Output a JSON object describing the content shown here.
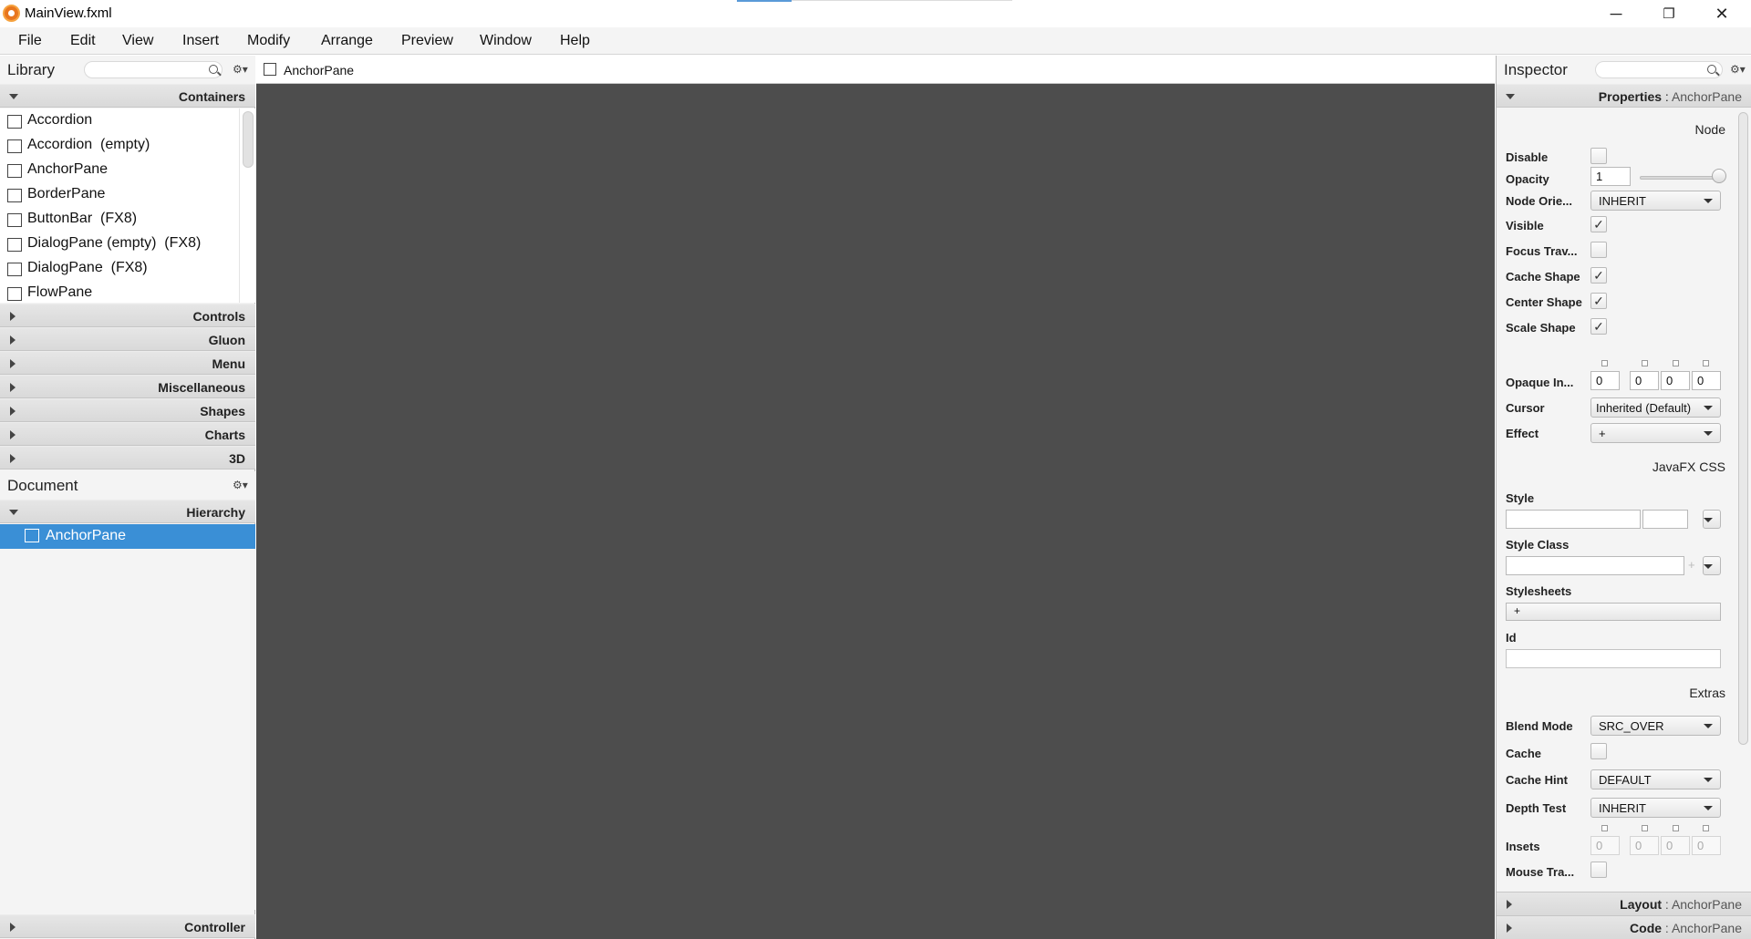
{
  "window": {
    "title": "MainView.fxml",
    "controls": {
      "minimize": "─",
      "restore": "❐",
      "close": "✕"
    }
  },
  "menu": [
    "File",
    "Edit",
    "View",
    "Insert",
    "Modify",
    "Arrange",
    "Preview",
    "Window",
    "Help"
  ],
  "library": {
    "title": "Library",
    "gear": "⚙▾",
    "open_section": "Containers",
    "items": [
      "Accordion",
      "Accordion  (empty)",
      "AnchorPane",
      "BorderPane",
      "ButtonBar  (FX8)",
      "DialogPane (empty)  (FX8)",
      "DialogPane  (FX8)",
      "FlowPane"
    ],
    "sections": [
      "Controls",
      "Gluon",
      "Menu",
      "Miscellaneous",
      "Shapes",
      "Charts",
      "3D"
    ]
  },
  "document": {
    "title": "Document",
    "gear": "⚙▾",
    "hierarchy_label": "Hierarchy",
    "selected_node": "AnchorPane",
    "controller_label": "Controller"
  },
  "canvas": {
    "breadcrumb": "AnchorPane"
  },
  "inspector": {
    "title": "Inspector",
    "gear": "⚙▾",
    "properties_label": "Properties",
    "separator": " : ",
    "target": "AnchorPane",
    "groups": {
      "node": "Node",
      "css": "JavaFX CSS",
      "extras": "Extras"
    },
    "node": {
      "disable": "Disable",
      "opacity": "Opacity",
      "opacity_value": "1",
      "node_orientation": "Node Orie...",
      "node_orientation_value": "INHERIT",
      "visible": "Visible",
      "focus_traversable": "Focus Trav...",
      "cache_shape": "Cache Shape",
      "center_shape": "Center Shape",
      "scale_shape": "Scale Shape",
      "opaque_insets": "Opaque In...",
      "opaque_insets_values": [
        "0",
        "0",
        "0",
        "0"
      ],
      "cursor": "Cursor",
      "cursor_value": "Inherited (Default)",
      "effect": "Effect",
      "effect_value": "+",
      "check_mark": "✓"
    },
    "css": {
      "style": "Style",
      "style_class": "Style Class",
      "stylesheets": "Stylesheets",
      "stylesheets_add": "+",
      "id": "Id",
      "plus": "+"
    },
    "extras": {
      "blend_mode": "Blend Mode",
      "blend_mode_value": "SRC_OVER",
      "cache": "Cache",
      "cache_hint": "Cache Hint",
      "cache_hint_value": "DEFAULT",
      "depth_test": "Depth Test",
      "depth_test_value": "INHERIT",
      "insets": "Insets",
      "insets_values": [
        "0",
        "0",
        "0",
        "0"
      ],
      "mouse_transparent": "Mouse Tra..."
    },
    "footers": {
      "layout": "Layout",
      "code": "Code"
    }
  }
}
